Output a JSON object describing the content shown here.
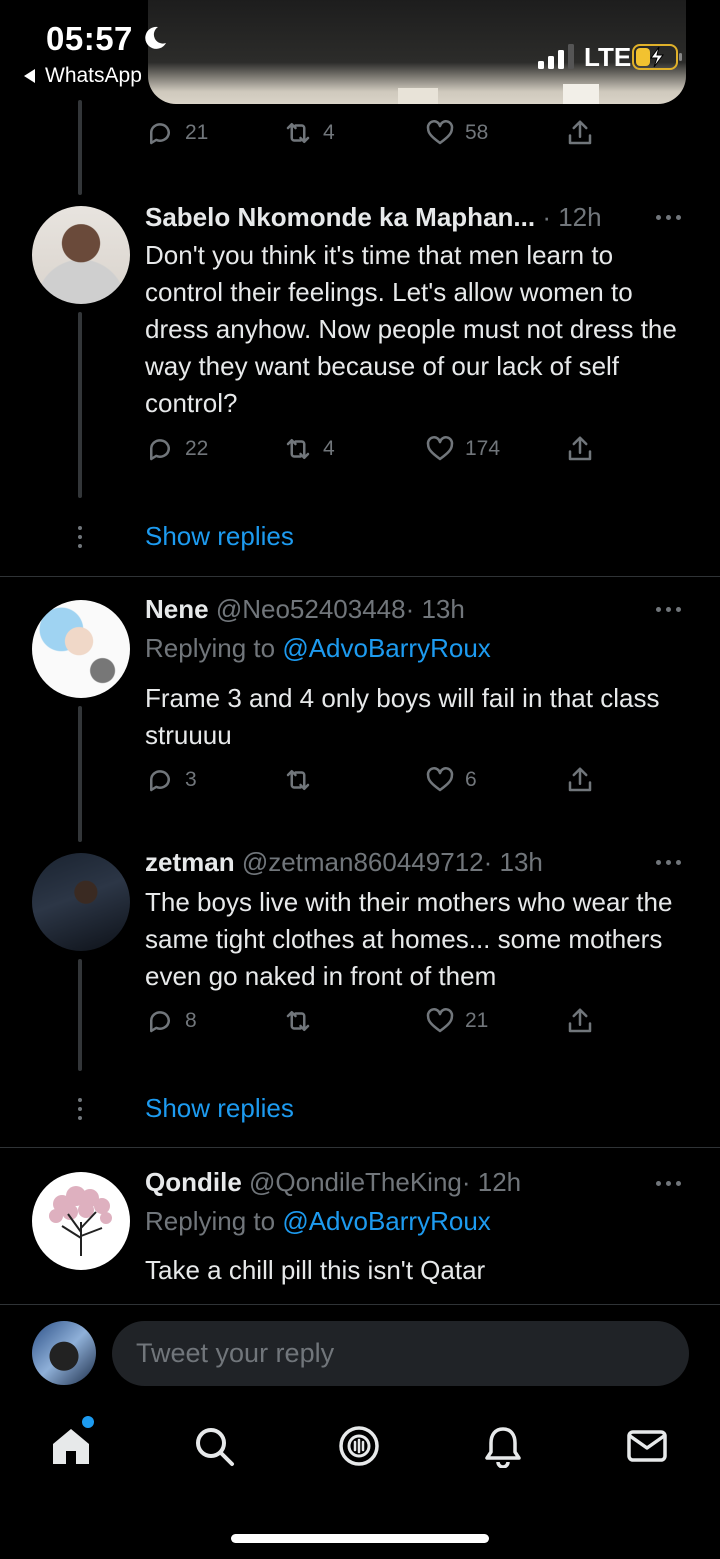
{
  "status_bar": {
    "time": "05:57",
    "back_app": "WhatsApp",
    "network": "LTE"
  },
  "top_tweet_actions": {
    "replies": "21",
    "retweets": "4",
    "likes": "58"
  },
  "tweets": [
    {
      "name": "Sabelo Nkomonde ka Maphan...",
      "meta": "· 12h",
      "text": "Don't you think it's time that men learn to control their feelings. Let's allow women to dress anyhow. Now people must not dress the way they want because of our lack of self control?",
      "replies": "22",
      "retweets": "4",
      "likes": "174"
    },
    {
      "name": "Nene",
      "handle": "@Neo52403448",
      "meta": "· 13h",
      "replying_label": "Replying to",
      "replying_to": "@AdvoBarryRoux",
      "text": "Frame 3 and 4 only boys will fail in that class struuuu",
      "replies": "3",
      "retweets": "",
      "likes": "6"
    },
    {
      "name": "zetman",
      "handle": "@zetman860449712",
      "meta": "· 13h",
      "text": "The boys live with their mothers who wear the same tight clothes at homes... some mothers even go naked in front of them",
      "replies": "8",
      "retweets": "",
      "likes": "21"
    },
    {
      "name": "Qondile",
      "handle": "@QondileTheKing",
      "meta": "· 12h",
      "replying_label": "Replying to",
      "replying_to": "@AdvoBarryRoux",
      "text": "Take a chill pill this isn't Qatar"
    }
  ],
  "show_replies": "Show replies",
  "reply_bar": {
    "placeholder": "Tweet your reply"
  },
  "tab_bar": {
    "icons": [
      "home-icon",
      "search-icon",
      "spaces-icon",
      "notifications-icon",
      "messages-icon"
    ],
    "accent": "#1d9bf0"
  },
  "colors": {
    "background": "#000000",
    "text": "#e7e9ea",
    "muted": "#71767b",
    "link": "#1d9bf0"
  }
}
